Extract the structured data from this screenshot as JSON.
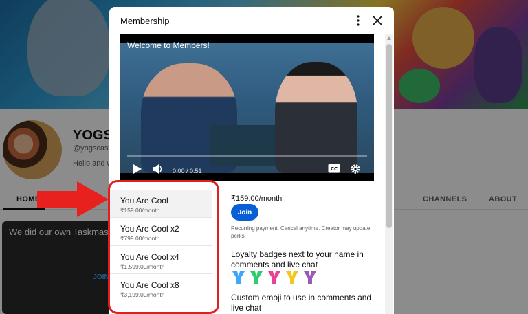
{
  "background": {
    "channel_name": "YOGSC",
    "channel_handle": "@yogscast",
    "channel_desc": "Hello and we",
    "tabs": [
      {
        "label": "HOME"
      },
      {
        "label": "CHANNELS"
      },
      {
        "label": "ABOUT"
      }
    ],
    "video_title": "We did our own Taskmaster",
    "video_join": "JOIN"
  },
  "dialog": {
    "title": "Membership",
    "player": {
      "title": "Welcome to Members!",
      "time": "0:00 / 0:51",
      "progress": 0.0
    },
    "tiers": [
      {
        "name": "You Are Cool",
        "price": "₹159.00/month",
        "selected": true
      },
      {
        "name": "You Are Cool x2",
        "price": "₹799.00/month",
        "selected": false
      },
      {
        "name": "You Are Cool x4",
        "price": "₹1,599.00/month",
        "selected": false
      },
      {
        "name": "You Are Cool x8",
        "price": "₹3,199.00/month",
        "selected": false
      }
    ],
    "detail": {
      "price": "₹159.00/month",
      "join_label": "Join",
      "note": "Recurring payment. Cancel anytime. Creator may update perks.",
      "perk_badges": "Loyalty badges next to your name in comments and live chat",
      "perk_emoji": "Custom emoji to use in comments and live chat"
    },
    "badge_colors": [
      "#3ea6ff",
      "#2ecc71",
      "#e84393",
      "#f5c518",
      "#9b59b6"
    ]
  },
  "colors": {
    "join_blue": "#065fd4",
    "highlight_red": "#e0201e"
  }
}
